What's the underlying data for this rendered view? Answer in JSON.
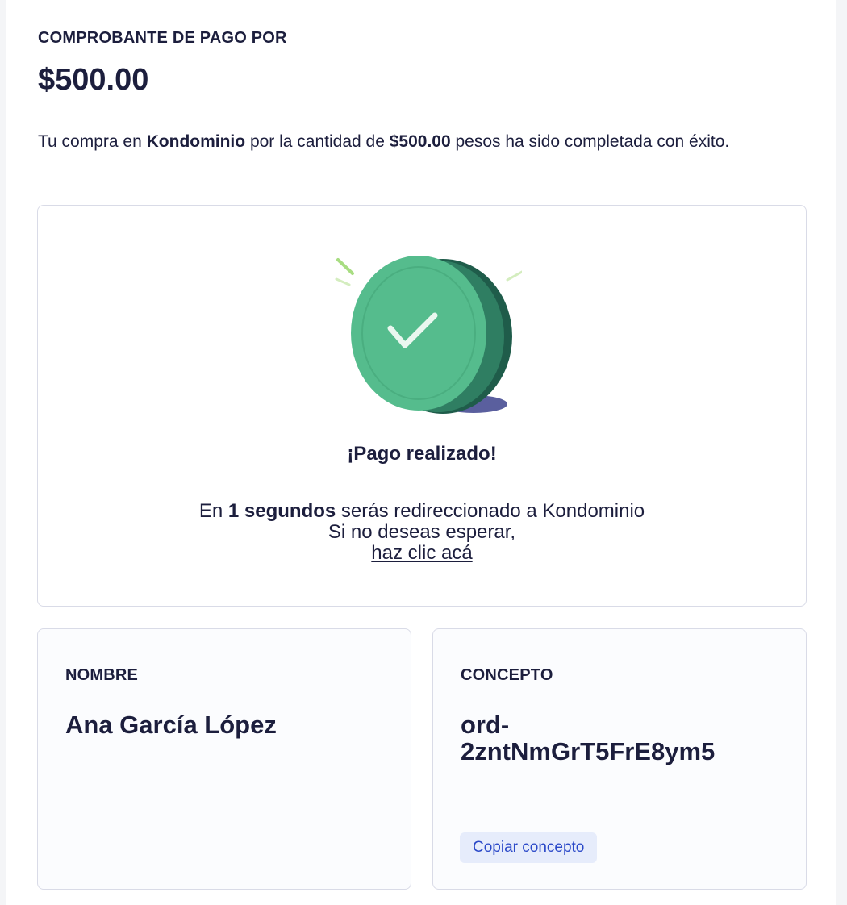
{
  "header": {
    "label": "COMPROBANTE DE PAGO POR",
    "amount": "$500.00"
  },
  "message": {
    "prefix": "Tu compra en ",
    "merchant": "Kondominio",
    "middle": " por la cantidad de ",
    "amount": "$500.00",
    "suffix": " pesos ha sido completada con éxito."
  },
  "success": {
    "title": "¡Pago realizado!",
    "redirect_prefix": "En ",
    "redirect_count": "1 segundos",
    "redirect_suffix": " serás redireccionado a Kondominio",
    "wait_text": "Si no deseas esperar,",
    "link_text": "haz clic acá",
    "illustration_icon": "coin-check-icon"
  },
  "details": {
    "name_label": "NOMBRE",
    "name_value": "Ana García López",
    "concept_label": "CONCEPTO",
    "concept_value": "ord-\n2zntNmGrT5FrE8ym5",
    "copy_button": "Copiar concepto"
  },
  "colors": {
    "text": "#1c1e3d",
    "coin_green": "#55bc8d",
    "button_bg": "#e6ecfb",
    "button_text": "#2a48c8"
  }
}
